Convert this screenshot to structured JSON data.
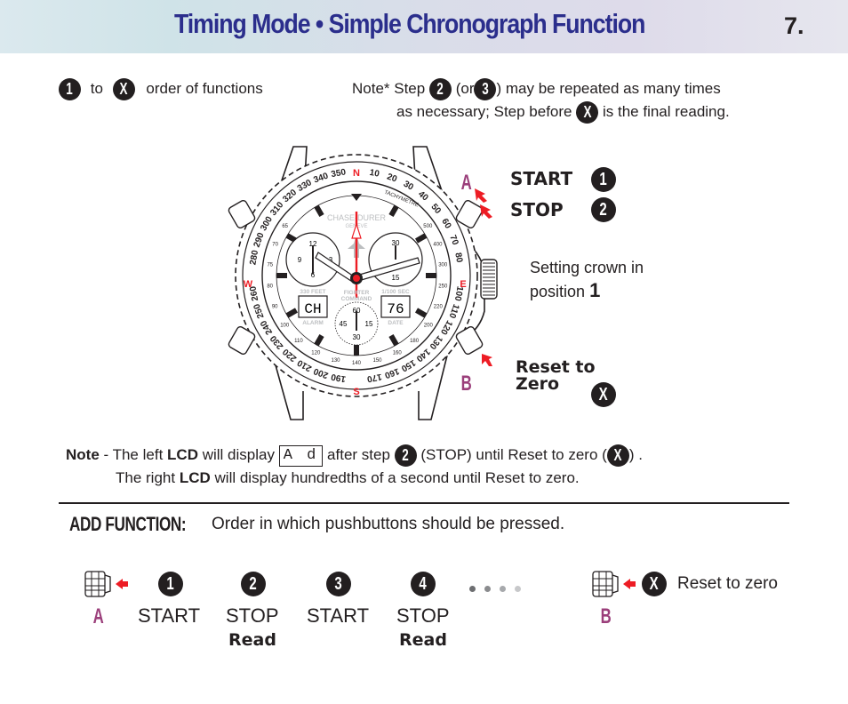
{
  "header": {
    "title": "Timing Mode • Simple Chronograph Function",
    "page_number": "7."
  },
  "legend": {
    "start_num": "1",
    "to_text": "to",
    "end_num": "X",
    "order_text": "order of functions"
  },
  "note_top": {
    "line1_prefix": "Note* Step",
    "step_a": "2",
    "or_text": "(or",
    "step_b": "3",
    "line1_suffix": ") may be repeated as many times",
    "line2_prefix": "as necessary; Step before",
    "step_x": "X",
    "line2_suffix": "is the final reading."
  },
  "watch": {
    "brand": "CHASE-DURER",
    "brand_sub": "GENEVE",
    "bezel_label": "TACHYMETRE",
    "compass": {
      "N": "N",
      "E": "E",
      "S": "S",
      "W": "W"
    },
    "bezel_numbers": [
      "10",
      "20",
      "30",
      "40",
      "50",
      "60",
      "70",
      "80",
      "100",
      "110",
      "120",
      "130",
      "140",
      "150",
      "160",
      "170",
      "190",
      "200",
      "210",
      "220",
      "230",
      "240",
      "250",
      "260",
      "280",
      "290",
      "300",
      "310",
      "320",
      "330",
      "340",
      "350"
    ],
    "tachy_numbers": [
      "65",
      "70",
      "75",
      "80",
      "90",
      "100",
      "110",
      "120",
      "130",
      "140",
      "150",
      "160",
      "180",
      "200",
      "220",
      "250",
      "300",
      "400",
      "500"
    ],
    "left_subdial": [
      "12",
      "3",
      "6",
      "9"
    ],
    "right_subdial": [
      "30",
      "15"
    ],
    "bottom_subdial": [
      "60",
      "15",
      "30",
      "45"
    ],
    "left_lcd_top": "330 FEET",
    "left_lcd_value": "CH",
    "left_lcd_bottom": "ALARM",
    "center_label_1": "FIGHTER",
    "center_label_2": "COMMAND",
    "right_lcd_top": "1/100 SEC",
    "right_lcd_value": "76",
    "right_lcd_bottom": "DATE",
    "pusher_a": "A",
    "pusher_b": "B"
  },
  "right_labels": {
    "start": "START",
    "start_num": "1",
    "stop": "STOP",
    "stop_num": "2",
    "crown_line1": "Setting crown in",
    "crown_line2": "position",
    "crown_pos": "1",
    "reset_line1": "Reset to",
    "reset_line2": "Zero",
    "reset_num": "X"
  },
  "note_lcd": {
    "note_label": "Note",
    "line1_a": "- The left",
    "lcd1": "LCD",
    "line1_b": "will display",
    "lcd_display": "A d",
    "line1_c": "after step",
    "step": "2",
    "line1_d": "(STOP) until Reset to zero (",
    "step_x": "X",
    "line1_e": ") .",
    "line2_a": "The right",
    "lcd2": "LCD",
    "line2_b": "will display hundredths of a second until Reset to zero."
  },
  "add_function": {
    "title": "ADD FUNCTION:",
    "description": "Order in which pushbuttons should be pressed.",
    "pusher_a": "A",
    "pusher_b": "B",
    "steps": [
      {
        "num": "1",
        "label": "START",
        "sub": ""
      },
      {
        "num": "2",
        "label": "STOP",
        "sub": "Read"
      },
      {
        "num": "3",
        "label": "START",
        "sub": ""
      },
      {
        "num": "4",
        "label": "STOP",
        "sub": "Read"
      }
    ],
    "reset_num": "X",
    "reset_label": "Reset to zero"
  },
  "colors": {
    "title_blue": "#2b2e8c",
    "accent_red": "#ed1c24",
    "pusher_magenta": "#9b3f7b"
  }
}
